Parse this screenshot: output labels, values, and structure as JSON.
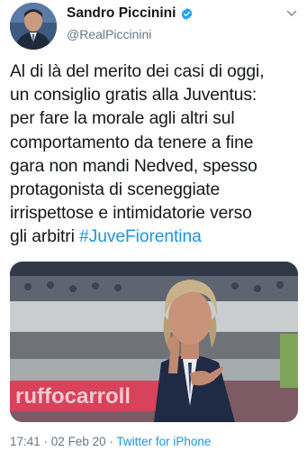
{
  "author": {
    "display_name": "Sandro Piccinini",
    "handle": "@RealPiccinini",
    "verified": true,
    "verified_icon": "verified-badge-icon",
    "verified_color": "#1da1f2"
  },
  "menu": {
    "icon": "chevron-down-icon"
  },
  "tweet": {
    "text": "Al di là del merito dei casi di oggi,\nun consiglio gratis alla Juventus:\nper fare la morale agli altri sul\ncomportamento da tenere a fine\ngara non mandi Nedved, spesso\nprotagonista di sceneggiate\nirrispettose e intimidatorie verso\ngli arbitri ",
    "hashtag": "#JuveFiorentina",
    "hashtag_color": "#1b95e0"
  },
  "media": {
    "banner_text": "ruffocarroll"
  },
  "meta": {
    "time": "17:41",
    "separator": " · ",
    "date": "02 Feb 20",
    "source": "Twitter for iPhone"
  }
}
